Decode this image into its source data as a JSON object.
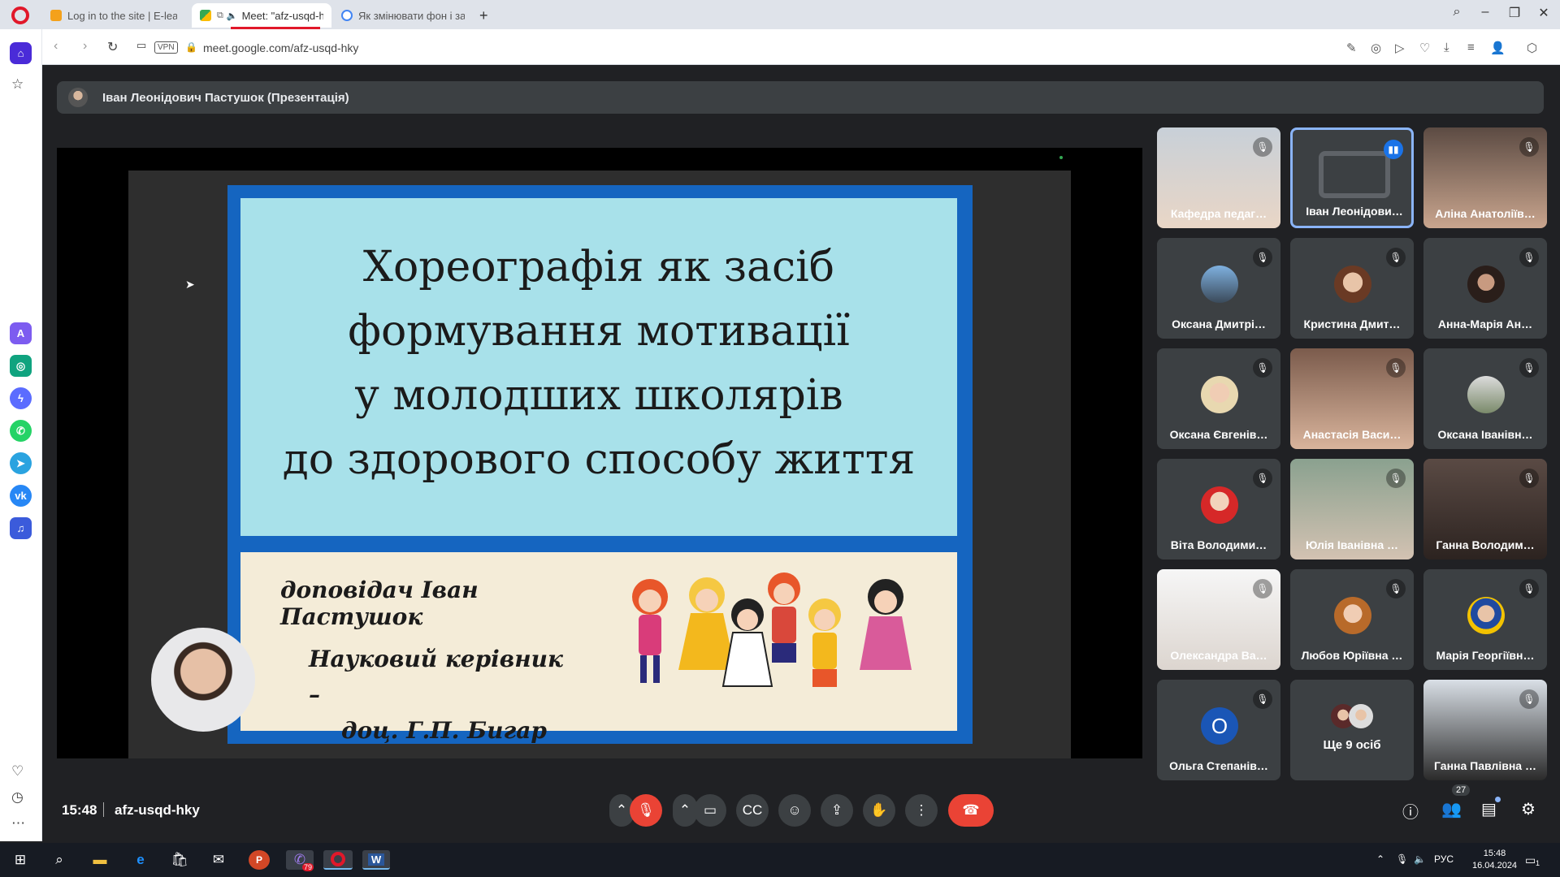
{
  "browser": {
    "tabs": [
      {
        "label": "Log in to the site | E-learni",
        "active": false
      },
      {
        "label": "Meet: \"afz-usqd-h",
        "active": true
      },
      {
        "label": "Як змінювати фон і засто",
        "active": false
      }
    ],
    "vpn_label": "VPN",
    "url": "meet.google.com/afz-usqd-hky"
  },
  "meet": {
    "presenter_label": "Іван Леонідович Пастушок (Презентація)",
    "slide": {
      "title_lines": [
        "Хореографія як засіб",
        "формування мотивації",
        "у молодших школярів",
        "до здорового способу життя"
      ],
      "speaker": "доповідач Іван Пастушок",
      "advisor_lines": [
        "Науковий керівник –",
        "доц. Г.П. Бигар"
      ]
    },
    "participants": [
      {
        "name": "Кафедра педаг…",
        "muted": true,
        "video": true
      },
      {
        "name": "Іван Леонідови…",
        "muted": false,
        "speaking": true,
        "presenting": true
      },
      {
        "name": "Аліна Анатоліїв…",
        "muted": true,
        "video": true
      },
      {
        "name": "Оксана Дмитрі…",
        "muted": true
      },
      {
        "name": "Кристина Дмит…",
        "muted": true
      },
      {
        "name": "Анна-Марія Ан…",
        "muted": true
      },
      {
        "name": "Оксана Євгенів…",
        "muted": true
      },
      {
        "name": "Анастасія Васи…",
        "muted": true,
        "video": true
      },
      {
        "name": "Оксана Іванівн…",
        "muted": true
      },
      {
        "name": "Віта Володими…",
        "muted": true
      },
      {
        "name": "Юлія Іванівна …",
        "muted": true,
        "video": true
      },
      {
        "name": "Ганна Володим…",
        "muted": true,
        "video": true
      },
      {
        "name": "Олександра Ва…",
        "muted": true,
        "video": true
      },
      {
        "name": "Любов Юріївна …",
        "muted": true
      },
      {
        "name": "Марія Георгіївн…",
        "muted": true
      },
      {
        "name": "Ольга Степанів…",
        "muted": true,
        "initial": "О"
      },
      {
        "name": "Ще 9 осіб",
        "more": true
      },
      {
        "name": "Ганна Павлівна …",
        "muted": true,
        "video": true
      }
    ],
    "time": "15:48",
    "meeting_code": "afz-usqd-hky",
    "people_count": "27"
  },
  "taskbar": {
    "viber_badge": "79",
    "language": "РУС",
    "time": "15:48",
    "date": "16.04.2024",
    "notification_count": "1"
  },
  "colors": {
    "meet_bg": "#202124",
    "tile_bg": "#3c4043",
    "end_call": "#ea4335",
    "speaking_border": "#8ab4f8",
    "opera_red": "#e1182a"
  }
}
